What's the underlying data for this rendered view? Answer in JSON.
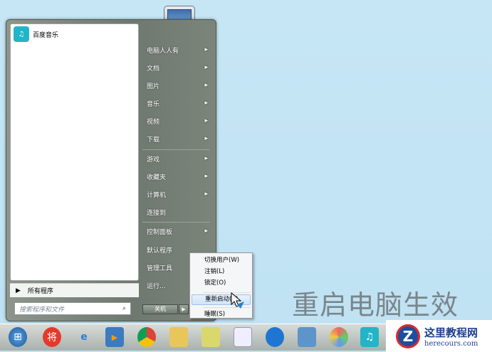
{
  "start_menu": {
    "pinned_programs": [
      {
        "label": "百度音乐",
        "icon": "baidu-music-icon"
      }
    ],
    "all_programs": "所有程序",
    "search_placeholder": "搜索程序和文件",
    "right_items": [
      {
        "label": "电脑人人有",
        "arrow": true
      },
      {
        "label": "文档",
        "arrow": true
      },
      {
        "label": "图片",
        "arrow": true
      },
      {
        "label": "音乐",
        "arrow": true
      },
      {
        "label": "视频",
        "arrow": true
      },
      {
        "label": "下载",
        "arrow": true
      },
      {
        "label": "游戏",
        "arrow": true
      },
      {
        "label": "收藏夹",
        "arrow": true
      },
      {
        "label": "计算机",
        "arrow": true
      },
      {
        "label": "连接到",
        "arrow": false
      },
      {
        "label": "控制面板",
        "arrow": true
      },
      {
        "label": "默认程序",
        "arrow": false
      },
      {
        "label": "管理工具",
        "arrow": true
      },
      {
        "label": "运行...",
        "arrow": false
      }
    ],
    "shutdown_label": "关机",
    "shutdown_submenu": [
      "切换用户(W)",
      "注销(L)",
      "锁定(O)",
      "重新启动(R)",
      "睡眠(S)"
    ],
    "highlighted_submenu": "重新启动(R)"
  },
  "overlay_caption": "重启电脑生效",
  "watermark": {
    "title": "这里教程网",
    "url": "herecours.com"
  },
  "taskbar": [
    "start",
    "将",
    "e",
    "▶",
    "chrome",
    "folder",
    "notes",
    "file",
    "browser",
    "net",
    "pinwheel",
    "music"
  ]
}
